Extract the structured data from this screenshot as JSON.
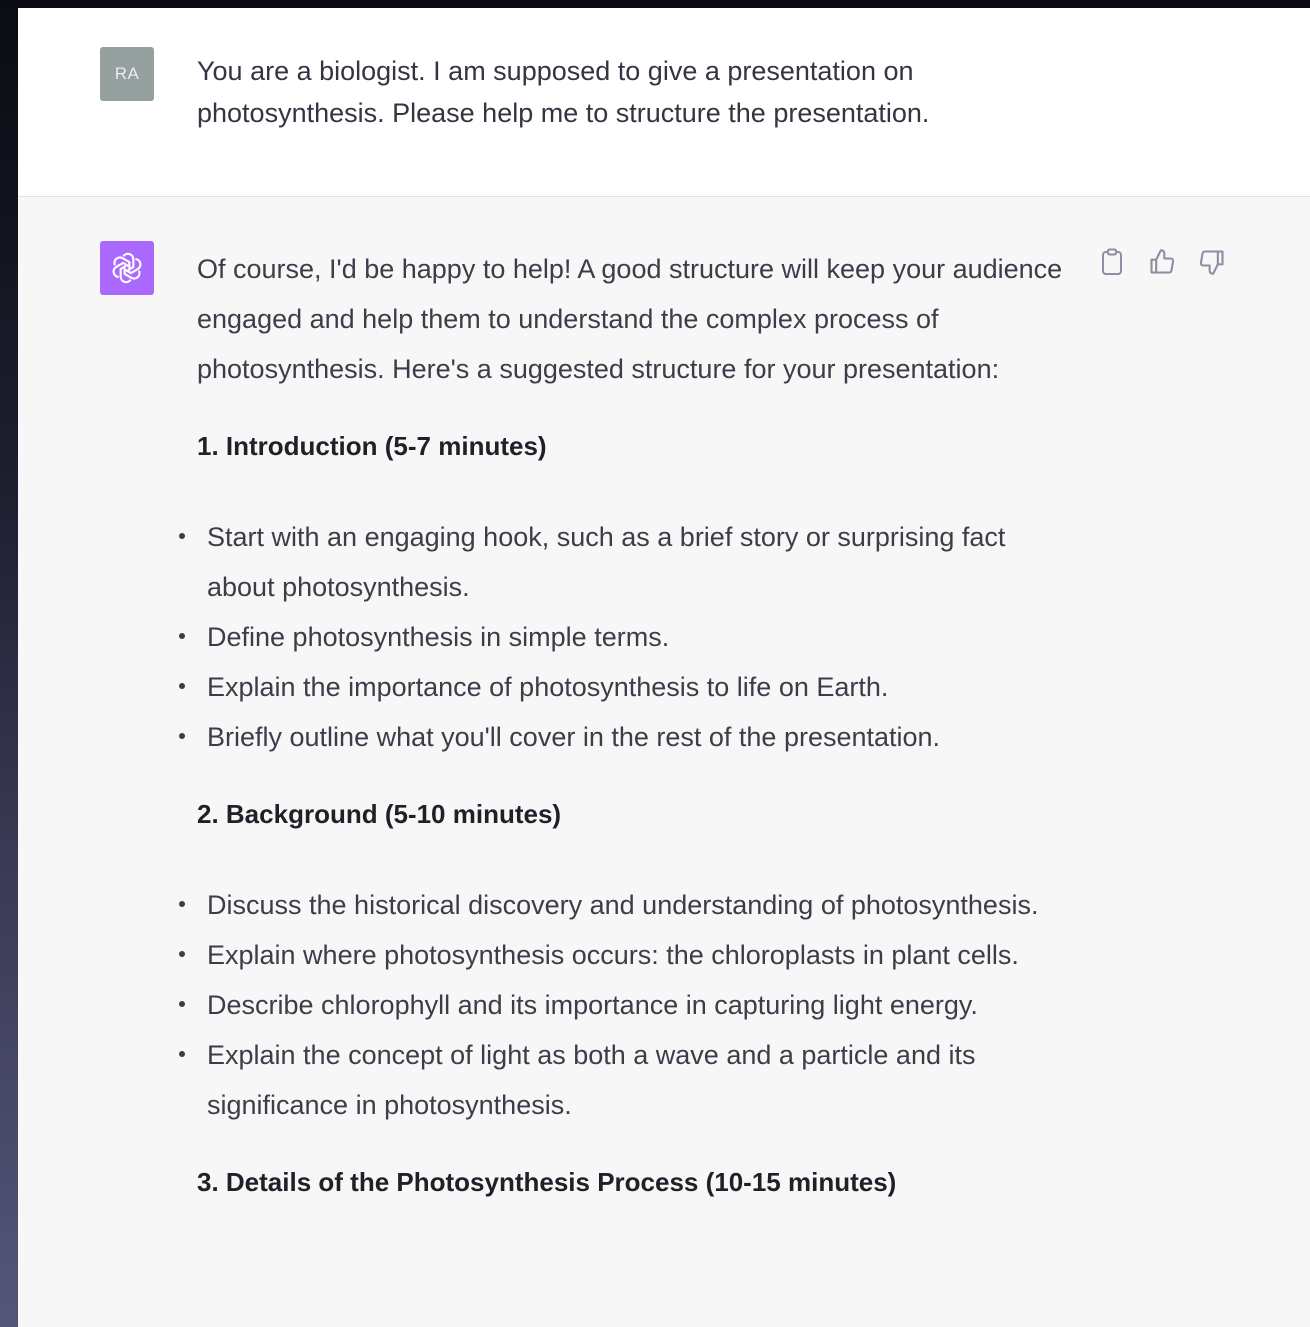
{
  "user": {
    "avatar_initials": "RA",
    "avatar_color": "#95a09f",
    "message": "You are a biologist. I am supposed to give a presentation on photosynthesis. Please help me to structure the presentation."
  },
  "assistant": {
    "avatar_icon": "openai-logo-icon",
    "avatar_color": "#ab68ff",
    "intro": "Of course, I'd be happy to help! A good structure will keep your audience engaged and help them to understand the complex process of photosynthesis. Here's a suggested structure for your presentation:",
    "actions": [
      {
        "icon": "copy-icon"
      },
      {
        "icon": "thumbs-up-icon"
      },
      {
        "icon": "thumbs-down-icon"
      }
    ],
    "sections": [
      {
        "heading": "1. Introduction (5-7 minutes)",
        "bullets": [
          "Start with an engaging hook, such as a brief story or surprising fact about photosynthesis.",
          "Define photosynthesis in simple terms.",
          "Explain the importance of photosynthesis to life on Earth.",
          "Briefly outline what you'll cover in the rest of the presentation."
        ]
      },
      {
        "heading": "2. Background (5-10 minutes)",
        "bullets": [
          "Discuss the historical discovery and understanding of photosynthesis.",
          "Explain where photosynthesis occurs: the chloroplasts in plant cells.",
          "Describe chlorophyll and its importance in capturing light energy.",
          "Explain the concept of light as both a wave and a particle and its significance in photosynthesis."
        ]
      },
      {
        "heading": "3. Details of the Photosynthesis Process (10-15 minutes)",
        "bullets": []
      }
    ]
  }
}
